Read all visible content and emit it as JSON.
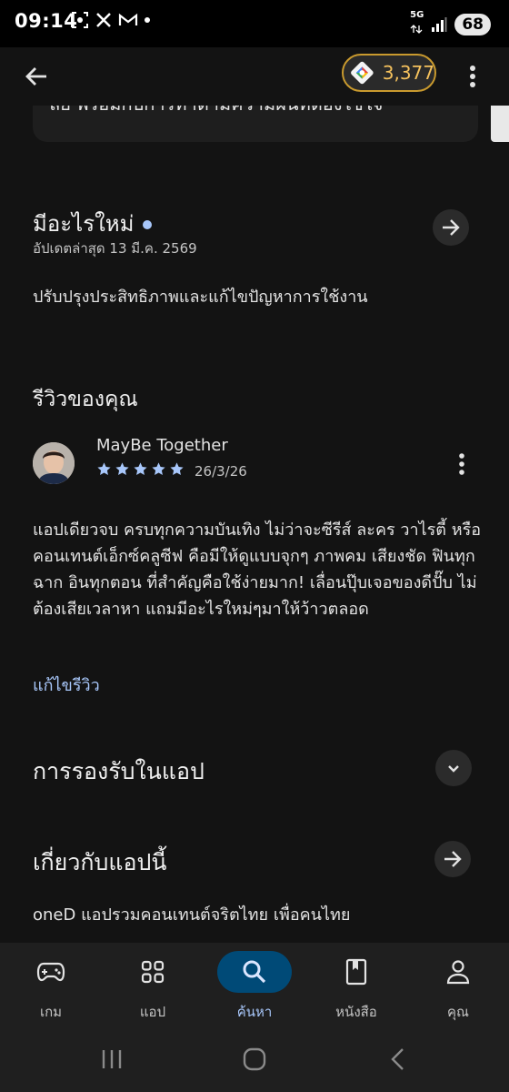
{
  "status_bar": {
    "time": "09:14",
    "network": "5G",
    "battery": "68"
  },
  "app_bar": {
    "points": "3,377"
  },
  "top_card": {
    "text": "ลย พร้อมกับการทำตามความฝันที่ต้องใช้ใจ"
  },
  "whats_new": {
    "title": "มีอะไรใหม่",
    "updated": "อัปเดตล่าสุด 13 มี.ค. 2569",
    "body": "ปรับปรุงประสิทธิภาพและแก้ไขปัญหาการใช้งาน"
  },
  "your_review": {
    "title": "รีวิวของคุณ",
    "reviewer": "MayBe Together",
    "rating": 5,
    "date": "26/3/26",
    "body": "แอปเดียวจบ ครบทุกความบันเทิง ไม่ว่าจะซีรีส์ ละคร วาไรตี้ หรือคอนเทนต์เอ็กซ์คลูซีฟ คือมีให้ดูแบบจุกๆ ภาพคม เสียงชัด ฟินทุกฉาก อินทุกตอน ที่สำคัญคือใช้ง่ายมาก! เลื่อนปุ๊บเจอของดีปั๊บ ไม่ต้องเสียเวลาหา แถมมีอะไรใหม่ๆมาให้ว้าวตลอด",
    "edit_link": "แก้ไขรีวิว"
  },
  "in_app_support": {
    "title": "การรองรับในแอป"
  },
  "about_app": {
    "title": "เกี่ยวกับแอปนี้",
    "body": "oneD แอปรวมคอนเทนต์จริตไทย เพื่อคนไทย"
  },
  "bottom_nav": {
    "items": [
      {
        "label": "เกม",
        "icon": "gamepad-icon"
      },
      {
        "label": "แอป",
        "icon": "apps-grid-icon"
      },
      {
        "label": "ค้นหา",
        "icon": "search-icon"
      },
      {
        "label": "หนังสือ",
        "icon": "book-icon"
      },
      {
        "label": "คุณ",
        "icon": "person-icon"
      }
    ],
    "active_index": 2
  },
  "colors": {
    "accent": "#a8c7fa",
    "active_pill": "#004a77",
    "points_text": "#f4c15d",
    "points_border": "#c99a2e",
    "background": "#131313"
  }
}
